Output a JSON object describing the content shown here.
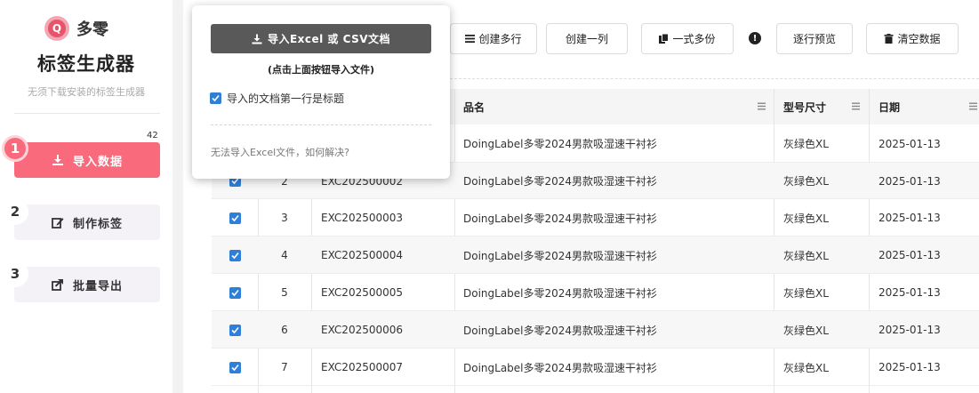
{
  "sidebar": {
    "logo_letter": "Q",
    "logo_text": "多零",
    "title": "标签生成器",
    "subtitle": "无须下载安装的标签生成器",
    "count": "42",
    "steps": [
      {
        "number": "1",
        "label": "导入数据"
      },
      {
        "number": "2",
        "label": "制作标签"
      },
      {
        "number": "3",
        "label": "批量导出"
      }
    ]
  },
  "toolbar": {
    "create_rows": "创建多行",
    "create_col": "创建一列",
    "multi_copy": "一式多份",
    "warn": "!",
    "row_preview": "逐行预览",
    "clear_data": "清空数据"
  },
  "popup": {
    "import_button": "导入Excel 或 CSV文档",
    "hint": "(点击上面按钮导入文件)",
    "header_checkbox_label": "导入的文档第一行是标题",
    "help_link": "无法导入Excel文件，如何解决?"
  },
  "table": {
    "headers": {
      "name": "品名",
      "size": "型号尺寸",
      "date": "日期"
    },
    "rows": [
      {
        "index": "",
        "code": "",
        "name": "DoingLabel多零2024男款吸湿速干衬衫",
        "size": "灰绿色XL",
        "date": "2025-01-13"
      },
      {
        "index": "2",
        "code": "EXC202500002",
        "name": "DoingLabel多零2024男款吸湿速干衬衫",
        "size": "灰绿色XL",
        "date": "2025-01-13"
      },
      {
        "index": "3",
        "code": "EXC202500003",
        "name": "DoingLabel多零2024男款吸湿速干衬衫",
        "size": "灰绿色XL",
        "date": "2025-01-13"
      },
      {
        "index": "4",
        "code": "EXC202500004",
        "name": "DoingLabel多零2024男款吸湿速干衬衫",
        "size": "灰绿色XL",
        "date": "2025-01-13"
      },
      {
        "index": "5",
        "code": "EXC202500005",
        "name": "DoingLabel多零2024男款吸湿速干衬衫",
        "size": "灰绿色XL",
        "date": "2025-01-13"
      },
      {
        "index": "6",
        "code": "EXC202500006",
        "name": "DoingLabel多零2024男款吸湿速干衬衫",
        "size": "灰绿色XL",
        "date": "2025-01-13"
      },
      {
        "index": "7",
        "code": "EXC202500007",
        "name": "DoingLabel多零2024男款吸湿速干衬衫",
        "size": "灰绿色XL",
        "date": "2025-01-13"
      }
    ]
  },
  "colors": {
    "accent": "#f96a7c",
    "checkbox": "#2f7fd6",
    "import_button": "#595959"
  }
}
